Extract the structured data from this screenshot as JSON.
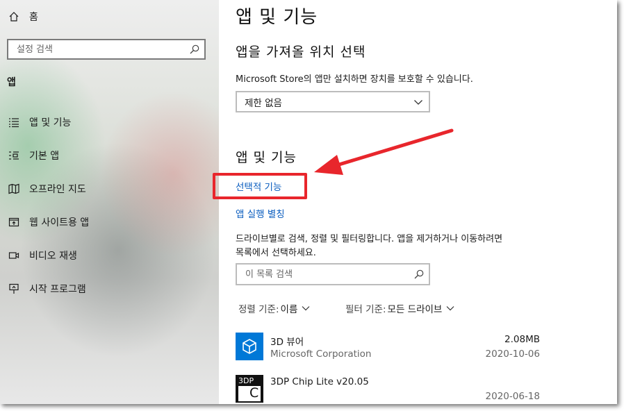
{
  "sidebar": {
    "home_label": "홈",
    "search_placeholder": "설정 검색",
    "section_label": "앱",
    "items": [
      {
        "label": "앱 및 기능",
        "icon": "list-icon"
      },
      {
        "label": "기본 앱",
        "icon": "default-apps-icon"
      },
      {
        "label": "오프라인 지도",
        "icon": "map-icon"
      },
      {
        "label": "웹 사이트용 앱",
        "icon": "web-app-icon"
      },
      {
        "label": "비디오 재생",
        "icon": "video-icon"
      },
      {
        "label": "시작 프로그램",
        "icon": "startup-icon"
      }
    ]
  },
  "main": {
    "title": "앱 및 기능",
    "install_section": {
      "heading": "앱을 가져올 위치 선택",
      "description": "Microsoft Store의 앱만 설치하면 장치를 보호할 수 있습니다.",
      "dropdown_value": "제한 없음"
    },
    "apps_section": {
      "heading": "앱 및 기능",
      "optional_features_link": "선택적 기능",
      "app_aliases_link": "앱 실행 별칭",
      "description_line1": "드라이브별로 검색, 정렬 및 필터링합니다. 앱을 제거하거나 이동하려면",
      "description_line2": "목록에서 선택하세요.",
      "search_placeholder": "이 목록 검색",
      "sort_label": "정렬 기준:",
      "sort_value": "이름",
      "filter_label": "필터 기준:",
      "filter_value": "모든 드라이브"
    },
    "apps": [
      {
        "name": "3D 뷰어",
        "publisher": "Microsoft Corporation",
        "size": "2.08MB",
        "date": "2020-10-06",
        "icon": "3d-viewer-icon",
        "icon_color": "#0078d7"
      },
      {
        "name": "3DP Chip Lite v20.05",
        "publisher": "",
        "size": "",
        "date": "2020-06-18",
        "icon": "3dp-chip-icon",
        "icon_color": "#111111",
        "icon_text_top": "3DP",
        "icon_text_bottom": "C"
      }
    ]
  },
  "annotation": {
    "color": "#e8262c"
  }
}
